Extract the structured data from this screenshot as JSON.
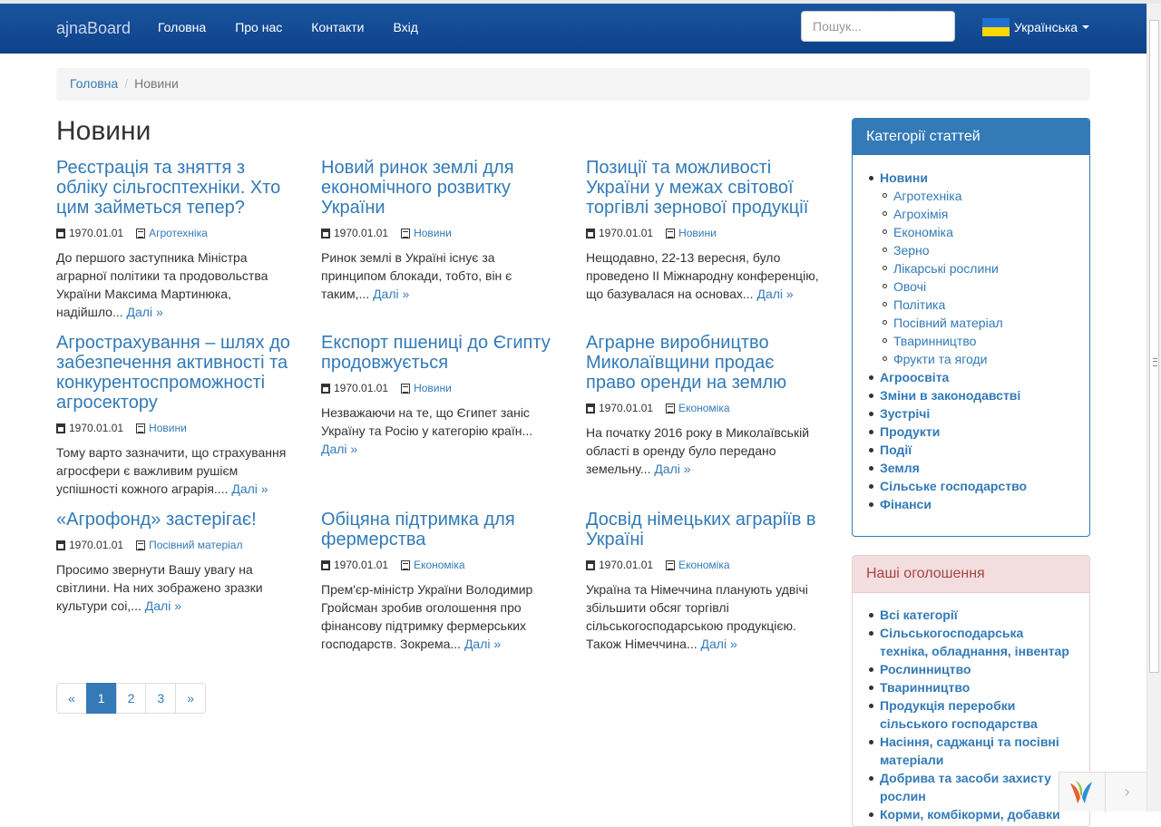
{
  "navbar": {
    "brand": "ajnaBoard",
    "links": [
      "Головна",
      "Про нас",
      "Контакти",
      "Вхід"
    ],
    "search_placeholder": "Пошук...",
    "language": "Українська"
  },
  "breadcrumb": {
    "home": "Головна",
    "current": "Новини"
  },
  "page_title": "Новини",
  "read_more": "Далі »",
  "articles": [
    {
      "title": "Реєстрація та зняття з обліку сільгосптехніки. Хто цим займеться тепер?",
      "date": "1970.01.01",
      "category": "Агротехніка",
      "teaser": "До першого заступника Міністра аграрної політики та продовольства України Максима Мартинюка, надійшло..."
    },
    {
      "title": "Новий ринок землі для економічного розвитку України",
      "date": "1970.01.01",
      "category": "Новини",
      "teaser": "Ринок землі в Україні існує за принципом блокади, тобто, він є таким,..."
    },
    {
      "title": "Позиції та можливості України у межах світової торгівлі зернової продукції",
      "date": "1970.01.01",
      "category": "Новини",
      "teaser": "Нещодавно, 22-13 вересня, було проведено ІІ Міжнародну конференцію, що базувалася на основах..."
    },
    {
      "title": "Агрострахування – шлях до забезпечення активності та конкурентоспроможності агросектору",
      "date": "1970.01.01",
      "category": "Новини",
      "teaser": "Тому варто зазначити, що страхування агросфери є важливим рушієм успішності кожного аграрія...."
    },
    {
      "title": "Експорт пшениці до Єгипту продовжується",
      "date": "1970.01.01",
      "category": "Новини",
      "teaser": "Незважаючи на те, що Єгипет заніс Україну та Росію у категорію країн..."
    },
    {
      "title": "Аграрне виробництво Миколаївщини продає право оренди на землю",
      "date": "1970.01.01",
      "category": "Економіка",
      "teaser": "На початку 2016 року в Миколаївській області в оренду було передано земельну..."
    },
    {
      "title": "«Агрофонд» застерігає!",
      "date": "1970.01.01",
      "category": "Посівний матеріал",
      "teaser": "Просимо звернути Вашу увагу на світлини. На них зображено зразки культури соі,..."
    },
    {
      "title": "Обіцяна підтримка для фермерства",
      "date": "1970.01.01",
      "category": "Економіка",
      "teaser": "Прем'єр-міністр України Володимир Гройсман зробив оголошення про фінансову підтримку фермерських господарств. Зокрема..."
    },
    {
      "title": "Досвід німецьких аграріїв в Україні",
      "date": "1970.01.01",
      "category": "Економіка",
      "teaser": "Україна та Німеччина планують удвічі збільшити обсяг торгівлі сільськогосподарською продукцією. Також Німеччина..."
    }
  ],
  "pagination": [
    "«",
    "1",
    "2",
    "3",
    "»"
  ],
  "categories_panel": {
    "title": "Категорії статтей",
    "top": "Новини",
    "sub": [
      "Агротехніка",
      "Агрохімія",
      "Економіка",
      "Зерно",
      "Лікарські рослини",
      "Овочі",
      "Політика",
      "Посівний матеріал",
      "Тваринництво",
      "Фрукти та ягоди"
    ],
    "others": [
      "Агроосвіта",
      "Зміни в законодавстві",
      "Зустрічі",
      "Продукти",
      "Події",
      "Земля",
      "Сільське господарство",
      "Фінанси"
    ]
  },
  "ads_panel": {
    "title": "Наші оголошення",
    "items": [
      "Всі категорії",
      "Сільськогосподарська техніка, обладнання, інвентар",
      "Рослинництво",
      "Тваринництво",
      "Продукція переробки сільського господарства",
      "Насіння, саджанці та посівні матеріали",
      "Добрива та засоби захисту рослин",
      "Корми, комбікорми, добавки"
    ]
  },
  "colors": {
    "navbar": "#0d4289",
    "link": "#337ab7",
    "primary_panel": "#337ab7",
    "danger_panel_bg": "#f2dede"
  }
}
